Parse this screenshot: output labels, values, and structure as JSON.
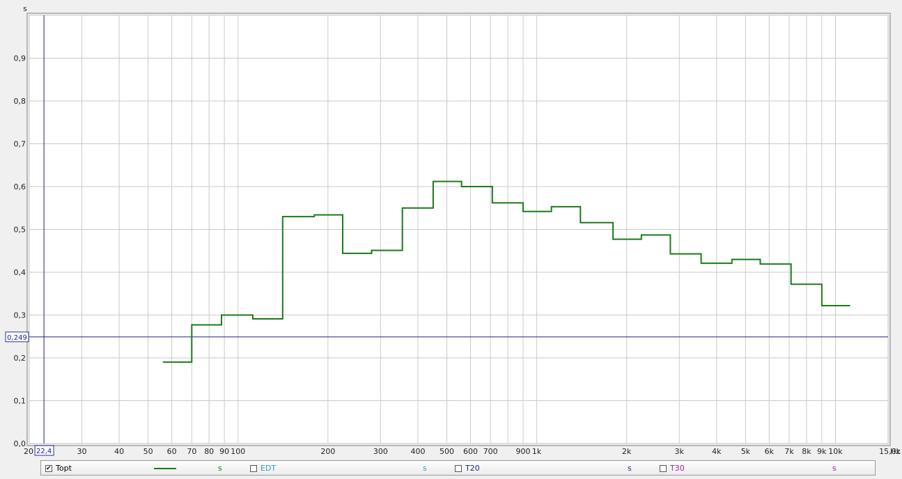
{
  "chart_data": {
    "type": "line",
    "y_unit_label": "s",
    "x_unit_label": "Hz",
    "y_ticks": [
      "0,0",
      "0,1",
      "0,2",
      "0,3",
      "0,4",
      "0,5",
      "0,6",
      "0,7",
      "0,8",
      "0,9"
    ],
    "y_tick_values": [
      0,
      0.1,
      0.2,
      0.3,
      0.4,
      0.5,
      0.6,
      0.7,
      0.8,
      0.9
    ],
    "x_ticks": [
      {
        "v": 20,
        "label": "20"
      },
      {
        "v": 30,
        "label": "30"
      },
      {
        "v": 40,
        "label": "40"
      },
      {
        "v": 50,
        "label": "50"
      },
      {
        "v": 60,
        "label": "60"
      },
      {
        "v": 70,
        "label": "70"
      },
      {
        "v": 80,
        "label": "80"
      },
      {
        "v": 90,
        "label": "90"
      },
      {
        "v": 100,
        "label": "100"
      },
      {
        "v": 200,
        "label": "200"
      },
      {
        "v": 300,
        "label": "300"
      },
      {
        "v": 400,
        "label": "400"
      },
      {
        "v": 500,
        "label": "500"
      },
      {
        "v": 600,
        "label": "600"
      },
      {
        "v": 700,
        "label": "700"
      },
      {
        "v": 900,
        "label": "900"
      },
      {
        "v": 1000,
        "label": "1k"
      },
      {
        "v": 2000,
        "label": "2k"
      },
      {
        "v": 3000,
        "label": "3k"
      },
      {
        "v": 4000,
        "label": "4k"
      },
      {
        "v": 5000,
        "label": "5k"
      },
      {
        "v": 6000,
        "label": "6k"
      },
      {
        "v": 7000,
        "label": "7k"
      },
      {
        "v": 8000,
        "label": "8k"
      },
      {
        "v": 9000,
        "label": "9k"
      },
      {
        "v": 10000,
        "label": "10k"
      },
      {
        "v": 15000,
        "label": "15,0k"
      }
    ],
    "x_gridlines": [
      20,
      30,
      40,
      50,
      60,
      70,
      80,
      90,
      100,
      200,
      300,
      400,
      500,
      600,
      700,
      800,
      900,
      1000,
      2000,
      3000,
      4000,
      5000,
      6000,
      7000,
      8000,
      9000,
      10000,
      15000
    ],
    "xlim": [
      20,
      15000
    ],
    "ylim": [
      0,
      1.0
    ],
    "x_scale": "log",
    "grid": true,
    "cursor": {
      "x": 22.4,
      "y": 0.249,
      "x_label": "22,4",
      "y_label": "0,249"
    },
    "series": [
      {
        "name": "Topt",
        "color": "#1a7a1a",
        "steps": [
          {
            "x0": 56,
            "x1": 70,
            "y": 0.19
          },
          {
            "x0": 70,
            "x1": 88,
            "y": 0.277
          },
          {
            "x0": 88,
            "x1": 112,
            "y": 0.3
          },
          {
            "x0": 112,
            "x1": 141,
            "y": 0.291
          },
          {
            "x0": 141,
            "x1": 180,
            "y": 0.53
          },
          {
            "x0": 180,
            "x1": 224,
            "y": 0.534
          },
          {
            "x0": 224,
            "x1": 280,
            "y": 0.444
          },
          {
            "x0": 280,
            "x1": 355,
            "y": 0.451
          },
          {
            "x0": 355,
            "x1": 450,
            "y": 0.55
          },
          {
            "x0": 450,
            "x1": 560,
            "y": 0.612
          },
          {
            "x0": 560,
            "x1": 710,
            "y": 0.6
          },
          {
            "x0": 710,
            "x1": 900,
            "y": 0.562
          },
          {
            "x0": 900,
            "x1": 1120,
            "y": 0.542
          },
          {
            "x0": 1120,
            "x1": 1400,
            "y": 0.553
          },
          {
            "x0": 1400,
            "x1": 1800,
            "y": 0.516
          },
          {
            "x0": 1800,
            "x1": 2240,
            "y": 0.477
          },
          {
            "x0": 2240,
            "x1": 2800,
            "y": 0.487
          },
          {
            "x0": 2800,
            "x1": 3550,
            "y": 0.443
          },
          {
            "x0": 3550,
            "x1": 4500,
            "y": 0.421
          },
          {
            "x0": 4500,
            "x1": 5600,
            "y": 0.43
          },
          {
            "x0": 5600,
            "x1": 7100,
            "y": 0.419
          },
          {
            "x0": 7100,
            "x1": 9000,
            "y": 0.372
          },
          {
            "x0": 9000,
            "x1": 11200,
            "y": 0.322
          }
        ]
      }
    ]
  },
  "legend": {
    "items": [
      {
        "label": "Topt",
        "checked": true,
        "color": "#1a7a1a",
        "unit": "s",
        "unit_color": "#1a7a1a",
        "show_line": true
      },
      {
        "label": "EDT",
        "checked": false,
        "color": "#2a9fb8",
        "unit": "s",
        "unit_color": "#2a9fb8",
        "show_line": false
      },
      {
        "label": "T20",
        "checked": false,
        "color": "#1a2a8a",
        "unit": "s",
        "unit_color": "#1a2a8a",
        "show_line": false
      },
      {
        "label": "T30",
        "checked": false,
        "color": "#a0289a",
        "unit": "s",
        "unit_color": "#a0289a",
        "show_line": false
      }
    ]
  }
}
